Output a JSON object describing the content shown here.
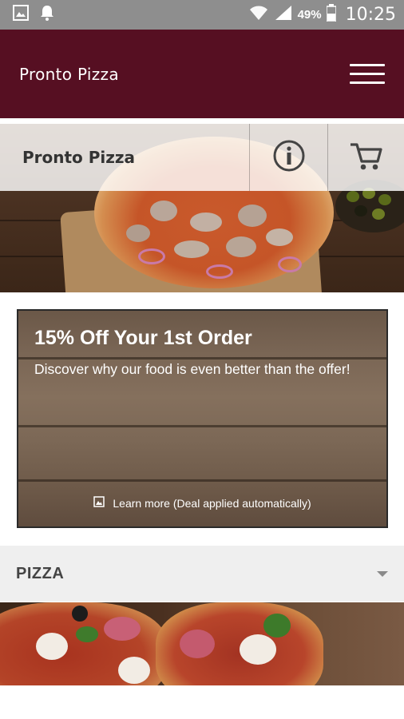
{
  "status_bar": {
    "battery": "49%",
    "time": "10:25",
    "icons": [
      "image-icon",
      "bell-icon",
      "wifi-icon",
      "signal-icon",
      "battery-icon"
    ]
  },
  "app_bar": {
    "title": "Pronto Pizza",
    "menu_icon": "hamburger-menu-icon",
    "background": "#560f22"
  },
  "hero": {
    "restaurant_name": "Pronto Pizza",
    "info_icon": "info-icon",
    "cart_icon": "cart-icon"
  },
  "offer": {
    "title": "15% Off Your 1st Order",
    "description": "Discover why our food is even better than the offer!",
    "link_text": "Learn more (Deal applied automatically)",
    "link_icon": "image-icon"
  },
  "category": {
    "label": "PIZZA",
    "toggle_icon": "caret-down-icon"
  }
}
